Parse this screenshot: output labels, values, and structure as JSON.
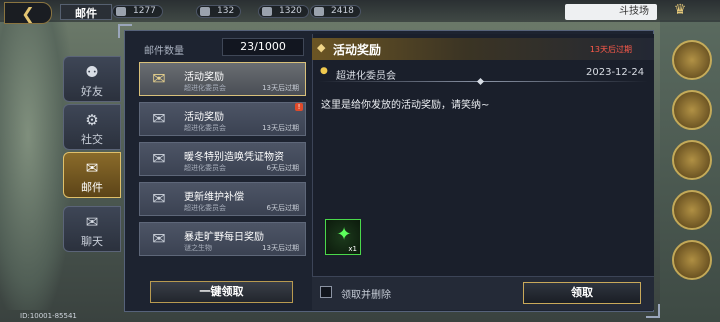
{
  "topbar": {
    "back_icon": "back-arrow-icon",
    "title": "邮件",
    "resources": [
      "1277",
      "132",
      "1320",
      "2418"
    ],
    "right_pill": "斗技场"
  },
  "tabs": [
    {
      "label": "好友",
      "icon": "friend-icon",
      "active": false
    },
    {
      "label": "社交",
      "icon": "social-icon",
      "active": false
    },
    {
      "label": "邮件",
      "icon": "mail-icon",
      "active": true
    },
    {
      "label": "聊天",
      "icon": "chat-icon",
      "active": false
    }
  ],
  "mail_list": {
    "count_label": "邮件数量",
    "count_value": "23/1000",
    "items": [
      {
        "title": "活动奖励",
        "sender": "超进化委员会",
        "expire": "13天后过期",
        "selected": true,
        "badge": ""
      },
      {
        "title": "活动奖励",
        "sender": "超进化委员会",
        "expire": "13天后过期",
        "selected": false,
        "badge": "!"
      },
      {
        "title": "暖冬特别造唤凭证物资",
        "sender": "超进化委员会",
        "expire": "6天后过期",
        "selected": false,
        "badge": ""
      },
      {
        "title": "更新维护补偿",
        "sender": "超进化委员会",
        "expire": "6天后过期",
        "selected": false,
        "badge": ""
      },
      {
        "title": "暴走旷野每日奖励",
        "sender": "谜之生物",
        "expire": "13天后过期",
        "selected": false,
        "badge": ""
      }
    ],
    "claim_all_label": "一键领取"
  },
  "detail": {
    "title": "活动奖励",
    "expire": "13天后过期",
    "sender": "超进化委员会",
    "date": "2023-12-24",
    "body": "这里是给你发放的活动奖励，请笑纳~",
    "reward": {
      "icon": "green-crystal-icon",
      "qty": "x1"
    },
    "checkbox_label": "领取并删除",
    "claim_label": "领取"
  },
  "footer": {
    "id": "ID:10001-85541"
  },
  "colors": {
    "accent_gold": "#d8c07a",
    "expire_red": "#ff5a4a",
    "reward_green": "#4bd84b"
  }
}
